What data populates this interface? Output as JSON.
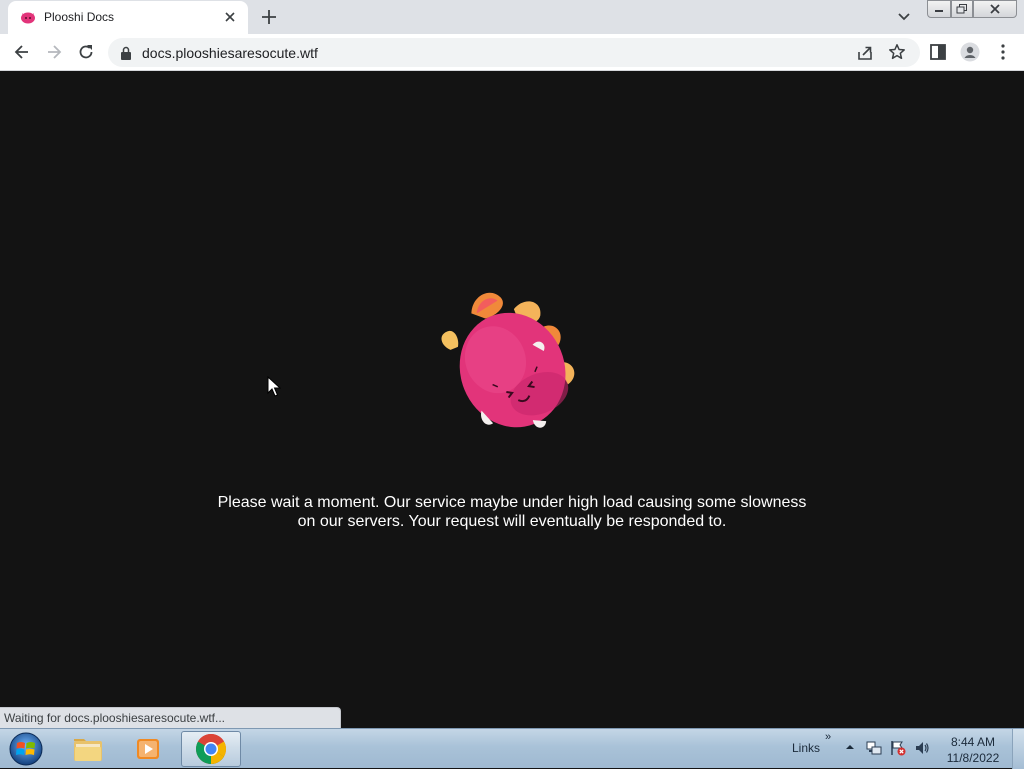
{
  "browser": {
    "tab": {
      "title": "Plooshi Docs"
    },
    "address_bar": {
      "url": "docs.plooshiesaresocute.wtf"
    }
  },
  "page": {
    "message_line1": "Please wait a moment. Our service maybe under high load causing some slowness",
    "message_line2": "on our servers. Your request will eventually be responded to.",
    "status_text": "Waiting for docs.plooshiesaresocute.wtf..."
  },
  "taskbar": {
    "links_label": "Links",
    "links_chevron": "»",
    "clock_time": "8:44 AM",
    "clock_date": "11/8/2022"
  },
  "colors": {
    "page_background": "#131313",
    "mascot_pink": "#e2347a",
    "mascot_orange": "#f0893a"
  },
  "icons": {
    "tab_favicon": "plooshi-favicon-icon",
    "back": "back-arrow-icon",
    "forward": "forward-arrow-icon",
    "reload": "reload-icon",
    "lock": "lock-icon",
    "share": "share-icon",
    "bookmark": "star-icon",
    "side_panel": "side-panel-icon",
    "profile": "profile-icon",
    "menu": "kebab-menu-icon"
  }
}
